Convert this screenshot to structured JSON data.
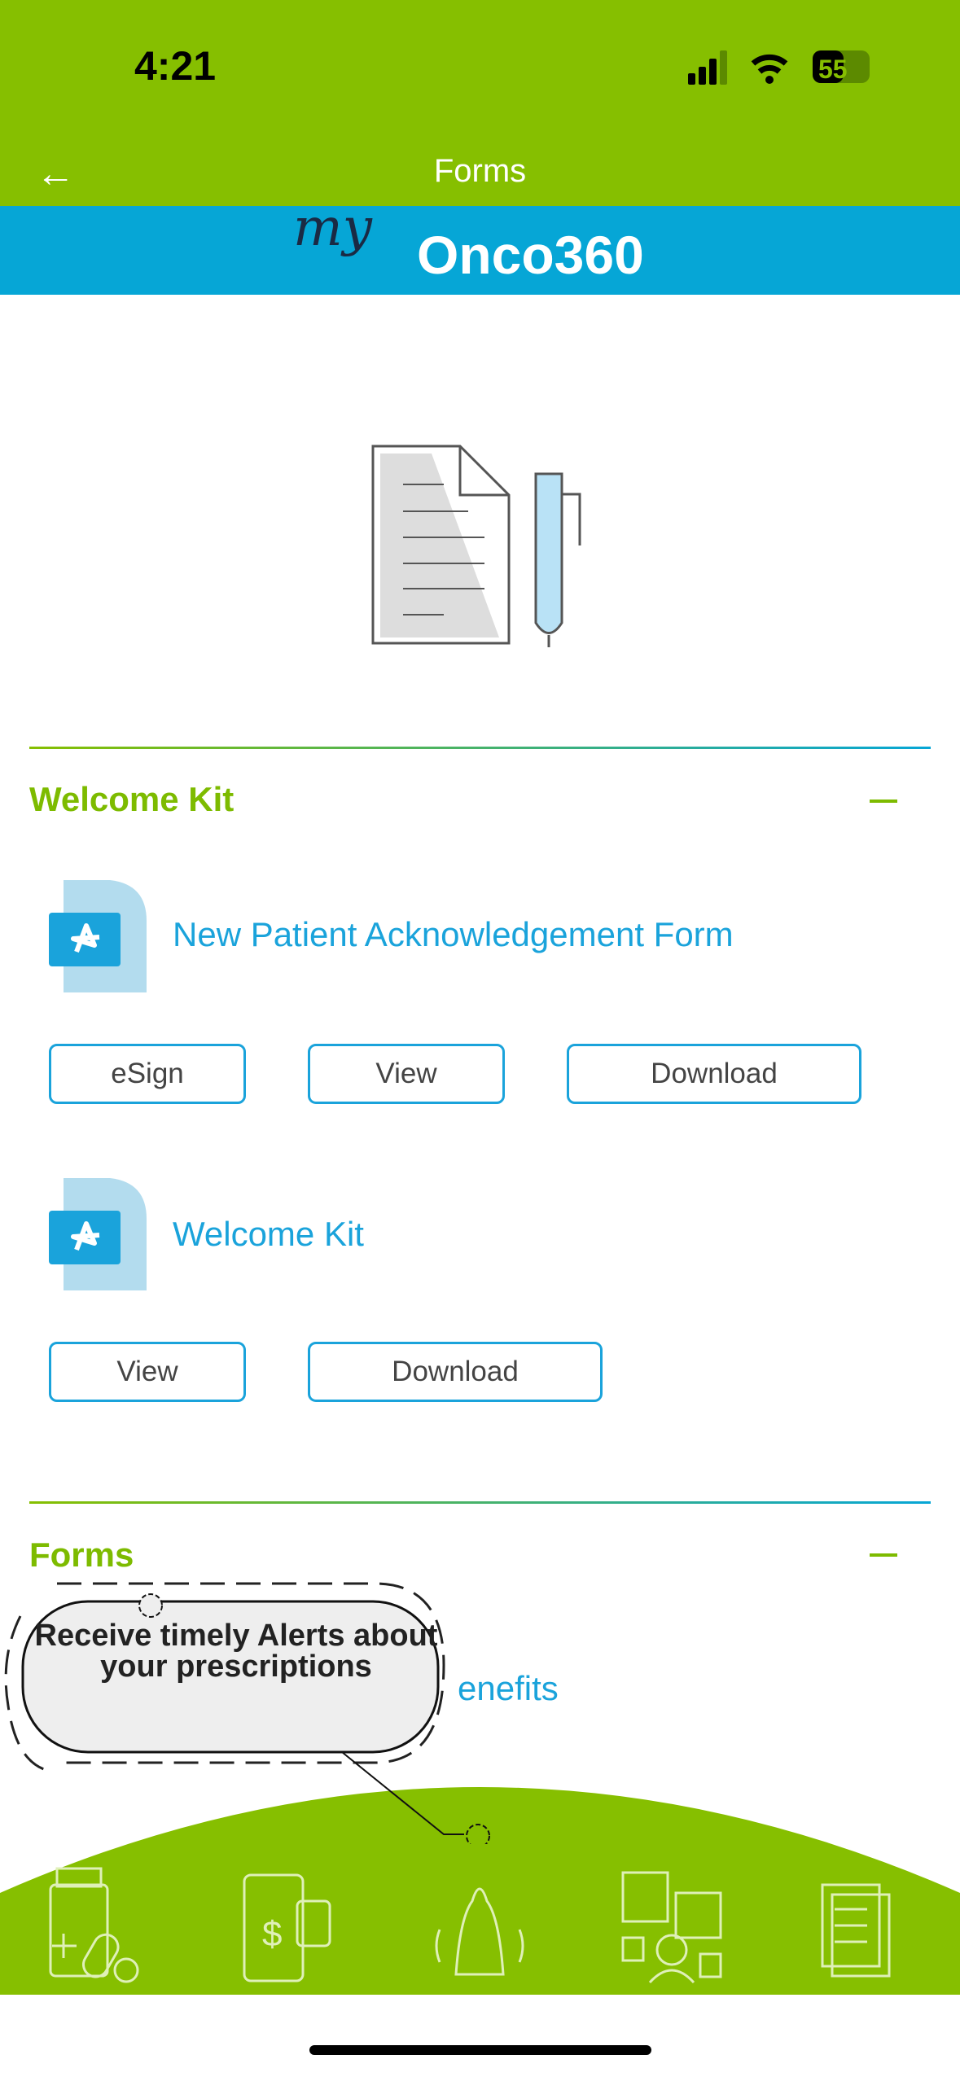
{
  "status_bar": {
    "time": "4:21",
    "battery": "55"
  },
  "header": {
    "title": "Forms",
    "back_icon": "arrow-left-icon"
  },
  "brand": {
    "logo_script": "my",
    "logo_text": "Onco360"
  },
  "colors": {
    "green": "#86bf00",
    "blue": "#06a6d6",
    "link": "#1aa3db"
  },
  "sections": [
    {
      "title": "Welcome Kit",
      "items": [
        {
          "title": "New Patient Acknowledgement Form",
          "buttons": [
            "eSign",
            "View",
            "Download"
          ]
        },
        {
          "title": "Welcome Kit",
          "buttons": [
            "View",
            "Download"
          ]
        }
      ]
    },
    {
      "title": "Forms",
      "items": [
        {
          "title": "enefits"
        }
      ]
    }
  ],
  "tooltip": {
    "text": "Receive timely Alerts about your prescriptions"
  },
  "bottom_nav": [
    "pill-bottle-icon",
    "phone-payment-lock-icon",
    "bell-icon",
    "support-chat-icon",
    "documents-icon"
  ]
}
